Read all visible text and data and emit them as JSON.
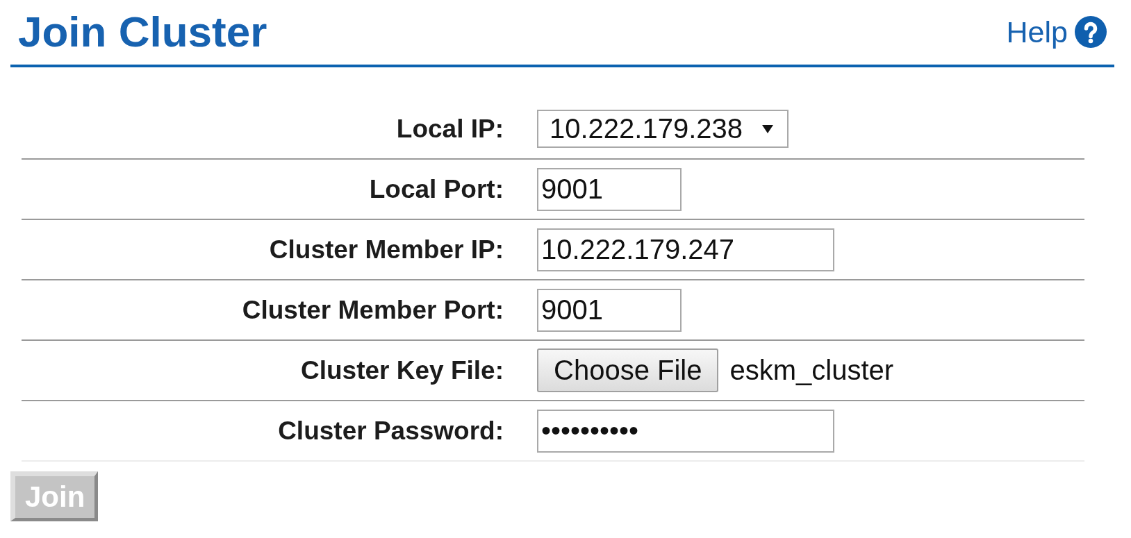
{
  "header": {
    "title": "Join Cluster",
    "help": {
      "label": "Help"
    }
  },
  "form": {
    "fields": [
      {
        "kind": "select",
        "label": "Local IP:",
        "value": "10.222.179.238"
      },
      {
        "kind": "number",
        "label": "Local Port:",
        "value": "9001"
      },
      {
        "kind": "text",
        "label": "Cluster Member IP:",
        "value": "10.222.179.247"
      },
      {
        "kind": "number",
        "label": "Cluster Member Port:",
        "value": "9001"
      },
      {
        "kind": "file",
        "label": "Cluster Key File:",
        "button": "Choose File",
        "value": "eskm_cluster"
      },
      {
        "kind": "password",
        "label": "Cluster Password:",
        "value": "••••••••••"
      }
    ]
  },
  "actions": [
    {
      "label": "Join",
      "disabled": true
    }
  ]
}
